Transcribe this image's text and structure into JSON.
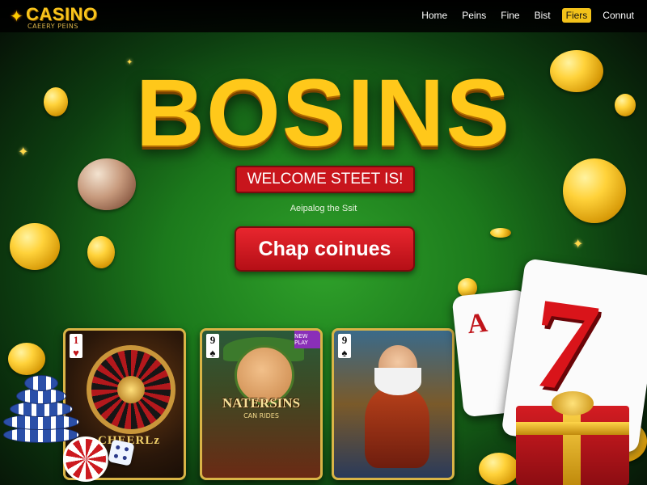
{
  "brand": {
    "title": "CASINO",
    "subtitle": "CAEERY PEINS"
  },
  "nav": {
    "items": [
      "Home",
      "Peins",
      "Fine",
      "Bist",
      "Fiers",
      "Connut"
    ],
    "active_index": 4
  },
  "hero": {
    "title": "BOSINS",
    "welcome_banner": "WELCOME STEET IS!",
    "tagline": "Aeipalog the Ssit",
    "cta_label": "Chap coinues"
  },
  "games": [
    {
      "corner_rank": "1",
      "corner_suit": "♥",
      "label": "CHEERLz"
    },
    {
      "corner_rank": "9",
      "corner_suit": "♠",
      "title": "NATERSINS",
      "subtitle": "CAN RIDES",
      "badge": "NEW PLAY"
    },
    {
      "corner_rank": "9",
      "corner_suit": "♠"
    }
  ],
  "cards": {
    "ace_letter": "A",
    "seven_glyph": "7"
  },
  "colors": {
    "accent_gold": "#ffc81a",
    "cta_red": "#c8151c",
    "felt_green": "#1c7a1c"
  },
  "icons": {
    "logo": "sparkle-star-icon",
    "sparkle": "sparkle-icon"
  }
}
